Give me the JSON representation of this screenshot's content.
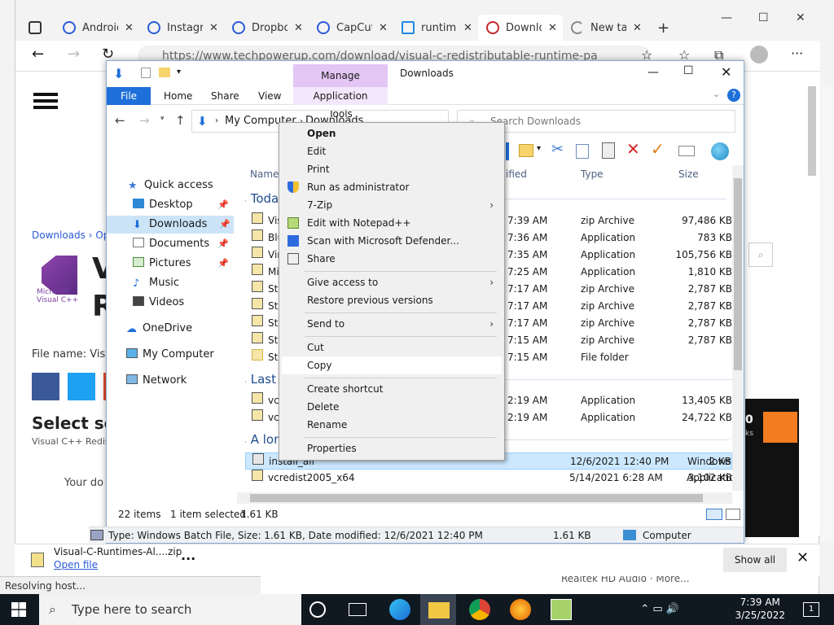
{
  "browser": {
    "tabs": [
      {
        "label": "Android"
      },
      {
        "label": "Instagram"
      },
      {
        "label": "Dropbox"
      },
      {
        "label": "CapCut"
      },
      {
        "label": "runtime"
      },
      {
        "label": "Downloads"
      },
      {
        "label": "New tab"
      }
    ],
    "url": "https://www.techpowerup.com/download/visual-c-redistributable-runtime-pa",
    "status": "Resolving host..."
  },
  "page_behind": {
    "breadcrumb": "Downloads › Op",
    "logo_text": "Microsoft Visual C++",
    "heading_fragment": "V",
    "heading_fragment2": "R",
    "filename_label": "File name: Visu",
    "select_label": "Select ser",
    "sub_label": "Visual C++ Redist",
    "your_do": "Your do",
    "ad_text": "Realtek HD Audio · More...",
    "ad_num": "0",
    "ad_sub": "ks"
  },
  "explorer": {
    "title": "Downloads",
    "manage_label": "Manage",
    "tabs": {
      "file": "File",
      "home": "Home",
      "share": "Share",
      "view": "View",
      "app_tools": "Application Tools"
    },
    "path": [
      "My Computer",
      "Downloads"
    ],
    "search_placeholder": "Search Downloads",
    "nav": {
      "quick_access": "Quick access",
      "desktop": "Desktop",
      "downloads": "Downloads",
      "documents": "Documents",
      "pictures": "Pictures",
      "music": "Music",
      "videos": "Videos",
      "onedrive": "OneDrive",
      "my_computer": "My Computer",
      "network": "Network"
    },
    "columns": {
      "name": "Name",
      "modified": "ified",
      "type": "Type",
      "size": "Size"
    },
    "groups": {
      "today": "Toda",
      "last": "Last",
      "along": "A lon"
    },
    "rows_today": [
      {
        "name": "Vis",
        "time": "7:39 AM",
        "type": "zip Archive",
        "size": "97,486 KB"
      },
      {
        "name": "Blu",
        "time": "7:36 AM",
        "type": "Application",
        "size": "783 KB"
      },
      {
        "name": "Vir",
        "time": "7:35 AM",
        "type": "Application",
        "size": "105,756 KB"
      },
      {
        "name": "Mi",
        "time": "7:25 AM",
        "type": "Application",
        "size": "1,810 KB"
      },
      {
        "name": "Sta",
        "time": "7:17 AM",
        "type": "zip Archive",
        "size": "2,787 KB"
      },
      {
        "name": "Sta",
        "time": "7:17 AM",
        "type": "zip Archive",
        "size": "2,787 KB"
      },
      {
        "name": "Sta",
        "time": "7:17 AM",
        "type": "zip Archive",
        "size": "2,787 KB"
      },
      {
        "name": "Sta",
        "time": "7:15 AM",
        "type": "zip Archive",
        "size": "2,787 KB"
      },
      {
        "name": "Sta",
        "time": "7:15 AM",
        "type": "File folder",
        "size": ""
      }
    ],
    "rows_last": [
      {
        "name": "vcr",
        "time": "2:19 AM",
        "type": "Application",
        "size": "13,405 KB"
      },
      {
        "name": "vcr",
        "time": "2:19 AM",
        "type": "Application",
        "size": "24,722 KB"
      }
    ],
    "rows_along": [
      {
        "name": "install_all",
        "time": "12/6/2021 12:40 PM",
        "type": "Windows Batch File",
        "size": "2 KB"
      },
      {
        "name": "vcredist2005_x64",
        "time": "5/14/2021 6:28 AM",
        "type": "Application",
        "size": "3,102 KB"
      }
    ],
    "status": {
      "count": "22 items",
      "selected": "1 item selected",
      "sel_size": "1.61 KB"
    },
    "details": {
      "info": "Type: Windows Batch File, Size: 1.61 KB, Date modified: 12/6/2021 12:40 PM",
      "size": "1.61 KB",
      "location": "Computer"
    }
  },
  "context_menu": {
    "items": [
      {
        "label": "Open"
      },
      {
        "label": "Edit"
      },
      {
        "label": "Print"
      },
      {
        "label": "Run as administrator"
      },
      {
        "label": "7-Zip"
      },
      {
        "label": "Edit with Notepad++"
      },
      {
        "label": "Scan with Microsoft Defender..."
      },
      {
        "label": "Share"
      },
      {
        "label": "Give access to"
      },
      {
        "label": "Restore previous versions"
      },
      {
        "label": "Send to"
      },
      {
        "label": "Cut"
      },
      {
        "label": "Copy"
      },
      {
        "label": "Create shortcut"
      },
      {
        "label": "Delete"
      },
      {
        "label": "Rename"
      },
      {
        "label": "Properties"
      }
    ]
  },
  "download_bar": {
    "file": "Visual-C-Runtimes-Al....zip",
    "open": "Open file",
    "show_all": "Show all"
  },
  "taskbar": {
    "search": "Type here to search",
    "time": "7:39 AM",
    "date": "3/25/2022"
  },
  "colors": {
    "accent": "#1e6fd9",
    "manage": "#e3c6f4",
    "selection": "#cce8ff",
    "taskbar": "#101820"
  }
}
